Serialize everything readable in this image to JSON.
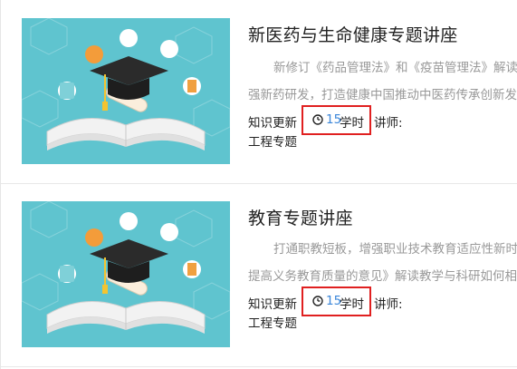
{
  "courses": [
    {
      "title": "新医药与生命健康专题讲座",
      "desc_line1": "新修订《药品管理法》和《疫苗管理法》解读",
      "desc_line2": "强新药研发，打造健康中国推动中医药传承创新发展",
      "meta_label": "知识更新",
      "hours_value": "15",
      "hours_unit": "学时",
      "teacher_label": "讲师:",
      "category": "工程专题",
      "thumb_icon": "graduation-cap-book-icon"
    },
    {
      "title": "教育专题讲座",
      "desc_line1": "打通职教短板，增强职业技术教育适应性新时代",
      "desc_line2": "提高义务教育质量的意见》解读教学与科研如何相互促进",
      "meta_label": "知识更新",
      "hours_value": "15",
      "hours_unit": "学时",
      "teacher_label": "讲师:",
      "category": "工程专题",
      "thumb_icon": "graduation-cap-book-icon"
    }
  ],
  "colors": {
    "thumb_bg": "#5fc4cf",
    "highlight_box": "#e02020",
    "hours_value": "#3a86d9"
  }
}
